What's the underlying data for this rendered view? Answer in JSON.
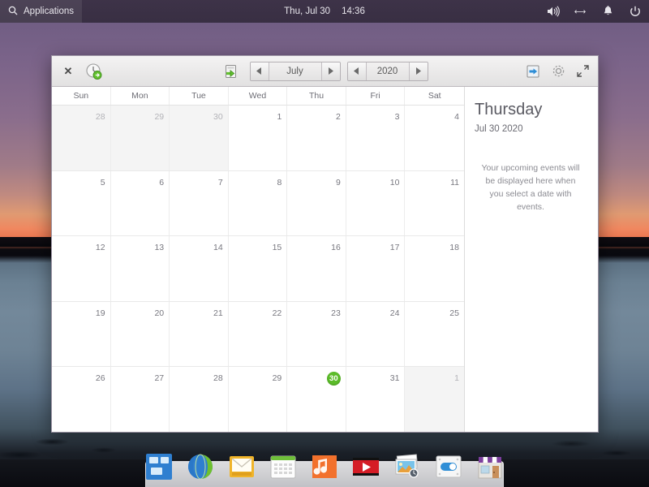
{
  "top_panel": {
    "applications_label": "Applications",
    "search_icon": "search-icon",
    "date": "Thu, Jul 30",
    "time": "14:36",
    "tray": [
      {
        "name": "volume-icon",
        "title": "Volume"
      },
      {
        "name": "network-icon",
        "title": "Network"
      },
      {
        "name": "notifications-bell-icon",
        "title": "Notifications"
      },
      {
        "name": "power-icon",
        "title": "Power"
      }
    ]
  },
  "calendar_window": {
    "toolbar": {
      "close_label": "✕",
      "today_icon": "clock-refresh-icon",
      "import_icon": "import-calendar-icon",
      "export_icon": "export-calendar-icon",
      "settings_icon": "gear-icon",
      "fullscreen_icon": "fullscreen-expand-icon",
      "prev_month_arrow": "◀",
      "next_month_arrow": "▶",
      "prev_year_arrow": "◀",
      "next_year_arrow": "▶",
      "month_value": "July",
      "year_value": "2020"
    },
    "day_headers": [
      "Sun",
      "Mon",
      "Tue",
      "Wed",
      "Thu",
      "Fri",
      "Sat"
    ],
    "weeks": [
      [
        {
          "day": "28",
          "other_month": true,
          "today": false
        },
        {
          "day": "29",
          "other_month": true,
          "today": false
        },
        {
          "day": "30",
          "other_month": true,
          "today": false
        },
        {
          "day": "1",
          "other_month": false,
          "today": false
        },
        {
          "day": "2",
          "other_month": false,
          "today": false
        },
        {
          "day": "3",
          "other_month": false,
          "today": false
        },
        {
          "day": "4",
          "other_month": false,
          "today": false
        }
      ],
      [
        {
          "day": "5",
          "other_month": false,
          "today": false
        },
        {
          "day": "6",
          "other_month": false,
          "today": false
        },
        {
          "day": "7",
          "other_month": false,
          "today": false
        },
        {
          "day": "8",
          "other_month": false,
          "today": false
        },
        {
          "day": "9",
          "other_month": false,
          "today": false
        },
        {
          "day": "10",
          "other_month": false,
          "today": false
        },
        {
          "day": "11",
          "other_month": false,
          "today": false
        }
      ],
      [
        {
          "day": "12",
          "other_month": false,
          "today": false
        },
        {
          "day": "13",
          "other_month": false,
          "today": false
        },
        {
          "day": "14",
          "other_month": false,
          "today": false
        },
        {
          "day": "15",
          "other_month": false,
          "today": false
        },
        {
          "day": "16",
          "other_month": false,
          "today": false
        },
        {
          "day": "17",
          "other_month": false,
          "today": false
        },
        {
          "day": "18",
          "other_month": false,
          "today": false
        }
      ],
      [
        {
          "day": "19",
          "other_month": false,
          "today": false
        },
        {
          "day": "20",
          "other_month": false,
          "today": false
        },
        {
          "day": "21",
          "other_month": false,
          "today": false
        },
        {
          "day": "22",
          "other_month": false,
          "today": false
        },
        {
          "day": "23",
          "other_month": false,
          "today": false
        },
        {
          "day": "24",
          "other_month": false,
          "today": false
        },
        {
          "day": "25",
          "other_month": false,
          "today": false
        }
      ],
      [
        {
          "day": "26",
          "other_month": false,
          "today": false
        },
        {
          "day": "27",
          "other_month": false,
          "today": false
        },
        {
          "day": "28",
          "other_month": false,
          "today": false
        },
        {
          "day": "29",
          "other_month": false,
          "today": false
        },
        {
          "day": "30",
          "other_month": false,
          "today": true
        },
        {
          "day": "31",
          "other_month": false,
          "today": false
        },
        {
          "day": "1",
          "other_month": true,
          "today": false
        }
      ]
    ],
    "sidebar": {
      "day_name": "Thursday",
      "full_date": "Jul 30 2020",
      "empty_message": "Your upcoming events will be displayed here when you select a date with events."
    }
  },
  "dock": {
    "items": [
      {
        "name": "dock-icon-windows-apps",
        "label": "Applications"
      },
      {
        "name": "dock-icon-web-browser",
        "label": "Web Browser"
      },
      {
        "name": "dock-icon-mail",
        "label": "Mail"
      },
      {
        "name": "dock-icon-calendar",
        "label": "Calendar"
      },
      {
        "name": "dock-icon-music",
        "label": "Music"
      },
      {
        "name": "dock-icon-video",
        "label": "Videos"
      },
      {
        "name": "dock-icon-photos",
        "label": "Photos"
      },
      {
        "name": "dock-icon-settings",
        "label": "Settings"
      },
      {
        "name": "dock-icon-software-store",
        "label": "Software"
      }
    ]
  },
  "colors": {
    "today_green": "#5cbc2a",
    "panel_purple": "#3a3044",
    "window_chrome": "#e8e7e7"
  }
}
